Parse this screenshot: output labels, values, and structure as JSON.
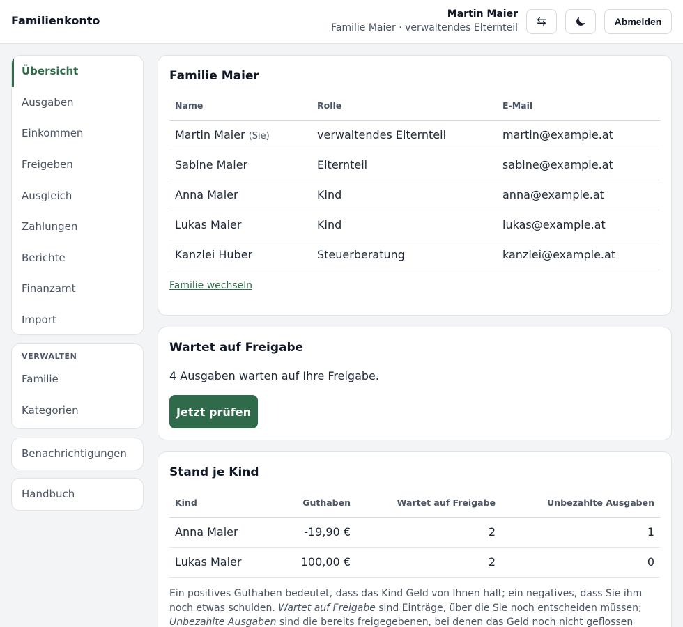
{
  "header": {
    "brand": "Familienkonto",
    "user_name": "Martin Maier",
    "user_sub": "Familie Maier · verwaltendes Elternteil",
    "switch_icon": "⇆",
    "logout_label": "Abmelden"
  },
  "nav": {
    "main": [
      "Übersicht",
      "Ausgaben",
      "Einkommen",
      "Freigeben",
      "Ausgleich",
      "Zahlungen",
      "Berichte",
      "Finanzamt",
      "Import"
    ],
    "manage_heading": "VERWALTEN",
    "manage": [
      "Familie",
      "Kategorien"
    ],
    "notifications": "Benachrichtigungen",
    "manual": "Handbuch"
  },
  "family": {
    "title": "Familie Maier",
    "columns": [
      "Name",
      "Rolle",
      "E-Mail"
    ],
    "members": [
      {
        "name": "Martin Maier",
        "tag": "(Sie)",
        "role": "verwaltendes Elternteil",
        "email": "martin@example.at"
      },
      {
        "name": "Sabine Maier",
        "tag": "",
        "role": "Elternteil",
        "email": "sabine@example.at"
      },
      {
        "name": "Anna Maier",
        "tag": "",
        "role": "Kind",
        "email": "anna@example.at"
      },
      {
        "name": "Lukas Maier",
        "tag": "",
        "role": "Kind",
        "email": "lukas@example.at"
      },
      {
        "name": "Kanzlei Huber",
        "tag": "",
        "role": "Steuerberatung",
        "email": "kanzlei@example.at"
      }
    ],
    "switch_link": "Familie wechseln"
  },
  "pending": {
    "title": "Wartet auf Freigabe",
    "text": "4 Ausgaben warten auf Ihre Freigabe.",
    "button": "Jetzt prüfen"
  },
  "kids": {
    "title": "Stand je Kind",
    "columns": [
      "Kind",
      "Guthaben",
      "Wartet auf Freigabe",
      "Unbezahlte Ausgaben"
    ],
    "rows": [
      {
        "kind": "Anna Maier",
        "guthaben": "-19,90 €",
        "wartet": "2",
        "unbezahlt": "1"
      },
      {
        "kind": "Lukas Maier",
        "guthaben": "100,00 €",
        "wartet": "2",
        "unbezahlt": "0"
      }
    ],
    "note_1": "Ein positives Guthaben bedeutet, dass das Kind Geld von Ihnen hält; ein negatives, dass Sie ihm noch etwas schulden. ",
    "note_em1": "Wartet auf Freigabe",
    "note_2": " sind Einträge, über die Sie noch entscheiden müssen; ",
    "note_em2": "Unbezahlte Ausgaben",
    "note_3": " sind die bereits freigegebenen, bei denen das Geld noch nicht geflossen ist. Beide zählen"
  },
  "colors": {
    "accent": "#2f6b4a"
  }
}
